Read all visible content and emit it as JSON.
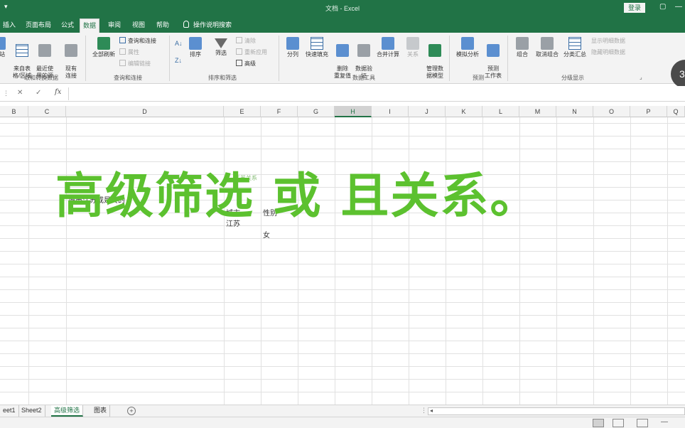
{
  "window": {
    "title": "文档 - Excel",
    "login_label": "登录",
    "qat_symbol": "▾",
    "restore_glyph": "▢",
    "minimize_glyph": "—"
  },
  "tabs": [
    {
      "label": "插入"
    },
    {
      "label": "页面布局"
    },
    {
      "label": "公式"
    },
    {
      "label": "数据",
      "active": true
    },
    {
      "label": "审阅"
    },
    {
      "label": "视图"
    },
    {
      "label": "帮助"
    },
    {
      "label": "操作说明搜索"
    }
  ],
  "ribbon": {
    "get_transform": {
      "btn_a": "站",
      "btn_from_table": "来自表\n格/区域",
      "btn_recent": "最近使\n用的源",
      "btn_existing": "现有\n连接",
      "group_label": "取和转换数据"
    },
    "queries": {
      "refresh_all": "全部刷新",
      "queries_connections": "查询和连接",
      "properties": "属性",
      "edit_links": "编辑链接",
      "group_label": "查询和连接"
    },
    "sort_filter": {
      "sort": "排序",
      "filter": "筛选",
      "clear": "清除",
      "reapply": "重新应用",
      "advanced": "高级",
      "group_label": "排序和筛选"
    },
    "data_tools": {
      "text_to_columns": "分列",
      "flash_fill": "快速填充",
      "remove_duplicates": "删除\n重复值",
      "data_validation": "数据验\n证",
      "consolidate": "合并计算",
      "relationships": "关系",
      "data_model": "管理数\n据模型",
      "group_label": "数据工具"
    },
    "forecast": {
      "what_if": "模拟分析",
      "forecast_sheet": "预测\n工作表",
      "group_label": "预测"
    },
    "outline": {
      "group": "组合",
      "ungroup": "取消组合",
      "subtotal": "分类汇总",
      "show_detail": "显示明细数据",
      "hide_detail": "隐藏明细数据",
      "group_label": "分级显示"
    },
    "floating_badge": "3"
  },
  "formula_bar": {
    "cancel": "✕",
    "confirm": "✓",
    "fx": "fx",
    "value": ""
  },
  "columns": [
    {
      "label": "B"
    },
    {
      "label": "C"
    },
    {
      "label": "D"
    },
    {
      "label": "E"
    },
    {
      "label": "F"
    },
    {
      "label": "G"
    },
    {
      "label": "H",
      "selected": true
    },
    {
      "label": "I"
    },
    {
      "label": "J"
    },
    {
      "label": "K"
    },
    {
      "label": "L"
    },
    {
      "label": "M"
    },
    {
      "label": "N"
    },
    {
      "label": "O"
    },
    {
      "label": "P"
    },
    {
      "label": "Q"
    }
  ],
  "cells": {
    "d_row_text": "城市江苏或是女的",
    "e_header_top": "江苏关系",
    "e_header": "城市",
    "f_header": "性别",
    "e_value": "江苏",
    "f_value": "女"
  },
  "overlay_title": "高级筛选 或 且关系。",
  "sheets": [
    {
      "label": "eet1"
    },
    {
      "label": "Sheet2"
    },
    {
      "label": "高级筛选",
      "active": true
    },
    {
      "label": "图表"
    }
  ],
  "sheetbar": {
    "add_symbol": "+",
    "dots": "⋮",
    "scroll_arrow": "◂"
  },
  "statusbar": {
    "zoom_minus": "—"
  }
}
